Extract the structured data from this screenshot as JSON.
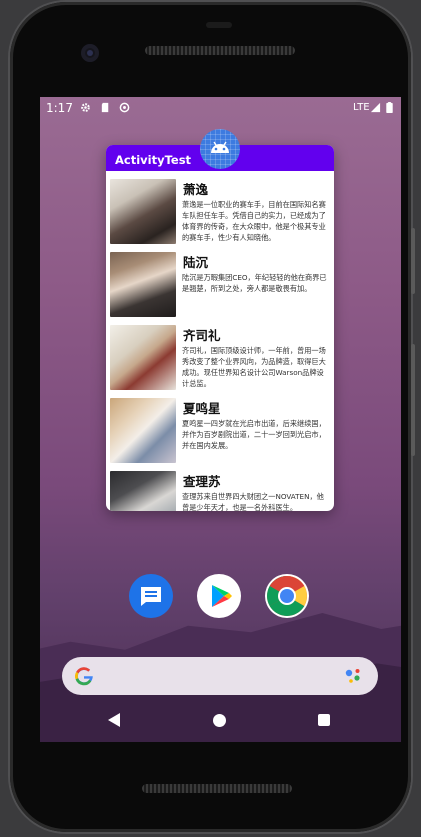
{
  "status_bar": {
    "time": "1:17",
    "network": "LTE"
  },
  "app": {
    "title": "ActivityTest",
    "accent_color": "#6200ee"
  },
  "list_items": [
    {
      "name": "萧逸",
      "desc": "萧逸是一位职业的赛车手，目前在国际知名赛车队担任车手。凭借自己的实力，已经成为了体育界的传奇，在大众眼中，他是个极其专业的赛车手，性少有人知晓他。"
    },
    {
      "name": "陆沉",
      "desc": "陆沉是万暇集团CEO，年纪轻轻的他在商界已是翘楚，所到之处，旁人都是敬畏有加。"
    },
    {
      "name": "齐司礼",
      "desc": "齐司礼，国际顶级设计师，一年前，曾用一场秀改变了整个业界风向，为品牌造，取得巨大成功。现任世界知名设计公司Warson品牌设计总监。"
    },
    {
      "name": "夏鸣星",
      "desc": "夏鸣星一四岁就在光启市出道，后来继续国，并作为百岁剧院出道，二十一岁回到光启市，并在国内发展。"
    },
    {
      "name": "查理苏",
      "desc": "查理苏来自世界四大财团之一NOVATEN，他曾是少年天才，也是一名外科医生。"
    }
  ],
  "icons": {
    "settings": "gear-icon",
    "storage": "sd-card-icon",
    "sync": "sync-icon",
    "signal": "signal-icon",
    "battery": "battery-icon"
  }
}
